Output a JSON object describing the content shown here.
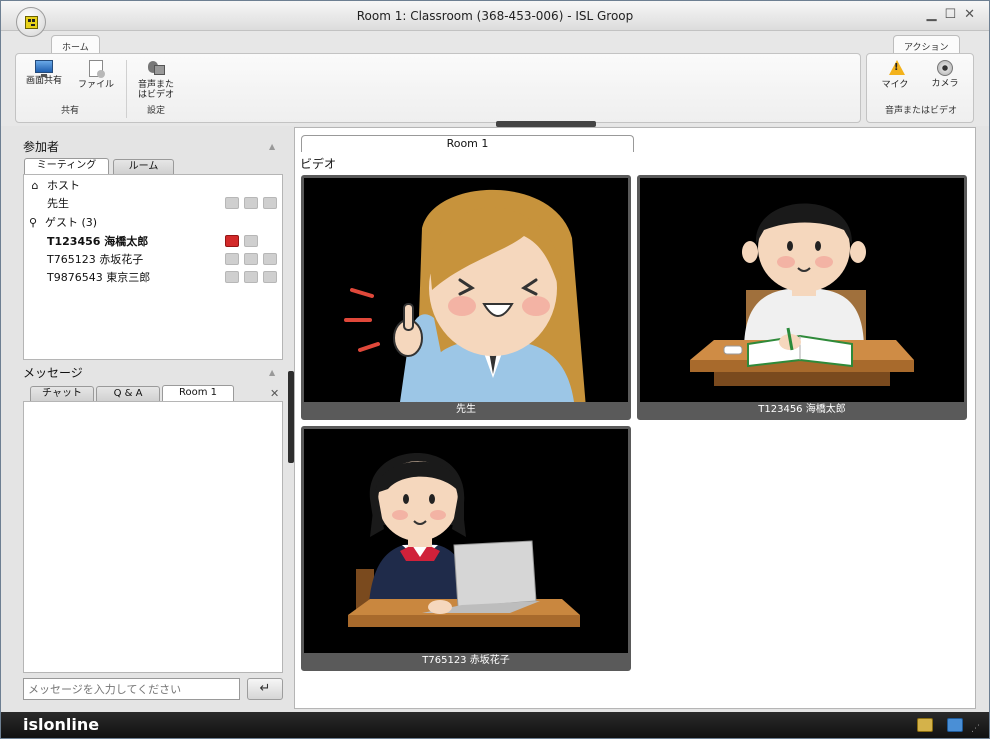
{
  "window": {
    "title": "Room 1: Classroom (368-453-006) - ISL Groop",
    "controls": [
      "▁",
      "☐",
      "✕"
    ]
  },
  "ribbon": {
    "home_tab": "ホーム",
    "action_tab": "アクション",
    "share_screen": "画面共有",
    "file": "ファイル",
    "audio_video_line1": "音声また",
    "audio_video_line2": "はビデオ",
    "group_share": "共有",
    "group_settings": "設定",
    "mic": "マイク",
    "camera": "カメラ",
    "group_av": "音声またはビデオ"
  },
  "participants": {
    "header": "参加者",
    "tab_meeting": "ミーティング",
    "tab_room": "ルーム",
    "host_label": "ホスト",
    "host_name": "先生",
    "guest_label": "ゲスト (3)",
    "guests": [
      {
        "name": "T123456 海橋太郎",
        "bold": true
      },
      {
        "name": "T765123 赤坂花子",
        "bold": false
      },
      {
        "name": "T9876543 東京三郎",
        "bold": false
      }
    ]
  },
  "messages": {
    "header": "メッセージ",
    "tab_chat": "チャット",
    "tab_qa": "Q & A",
    "tab_room": "Room 1",
    "input_placeholder": "メッセージを入力してください",
    "send_glyph": "↵"
  },
  "main": {
    "room_tab": "Room 1",
    "video_label": "ビデオ",
    "tiles": [
      {
        "caption": "先生"
      },
      {
        "caption": "T123456 海橋太郎"
      },
      {
        "caption": "T765123 赤坂花子"
      }
    ]
  },
  "statusbar": {
    "brand": "islonline"
  },
  "colors": {
    "highlight_red": "#d32a2a",
    "tile_border": "#5a5a5a",
    "statusbar_bg": "#1a1a1a"
  }
}
